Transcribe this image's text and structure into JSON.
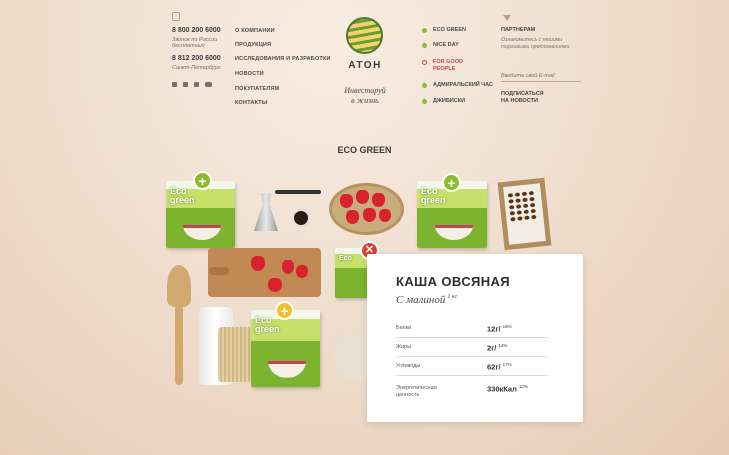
{
  "header": {
    "phone1": "8 800 200 6000",
    "phone1_note": [
      "Звонок по России",
      "бесплатный"
    ],
    "phone2": "8 812 200 6000",
    "phone2_note": "Санкт-Петербург",
    "social": [
      "vk-icon",
      "twitter-icon",
      "facebook-icon",
      "youtube-icon"
    ],
    "menu": [
      "О компании",
      "Продукция",
      "Исследования и разработки",
      "Новости",
      "Покупателям",
      "Контакты"
    ],
    "logo_title": "АТОН",
    "slogan": [
      "Инвестируй",
      "в жизнь"
    ],
    "brands": [
      {
        "label": "Eco Green",
        "style": "green"
      },
      {
        "label": "Nice Day",
        "style": "green"
      },
      {
        "label": "For good",
        "label2": "people",
        "style": "red"
      },
      {
        "label": "Адмиральский час",
        "style": "green"
      },
      {
        "label": "Джибиски",
        "style": "green"
      }
    ],
    "partners_label": "Партнерам",
    "partners_note": [
      "Ознакомьтесь с нашими",
      "торговыми предложениями"
    ],
    "email_placeholder": "Введите свой E-mail",
    "subscribe": [
      "Подписаться",
      "на новости"
    ]
  },
  "section_title": "ECO GREEN",
  "product_box_text": [
    "Eco",
    "green"
  ],
  "product_card": {
    "title": "КАША ОВСЯНАЯ",
    "subtitle": "С малиной",
    "weight": "1 кг",
    "nutrients": [
      {
        "name": "Белки",
        "value": "12г/",
        "pct": "18%"
      },
      {
        "name": "Жиры",
        "value": "2г/",
        "pct": "14%"
      },
      {
        "name": "Углеводы",
        "value": "62г/",
        "pct": "17%"
      },
      {
        "name": "Энергетическая ценность",
        "name1": "Энергетическая",
        "name2": "ценность",
        "value": "330кКал",
        "pct": "12%"
      }
    ]
  },
  "colors": {
    "accent_green": "#8dbb2e",
    "accent_red": "#d64534",
    "accent_yellow": "#f2c02e"
  }
}
